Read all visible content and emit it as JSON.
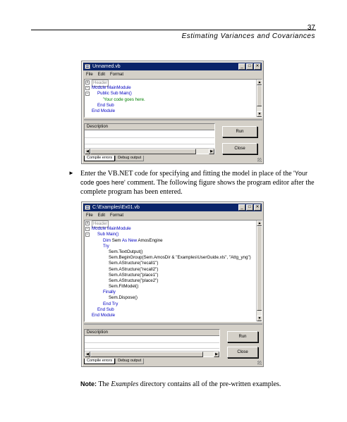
{
  "page": {
    "number": "37",
    "running_head": "Estimating Variances and Covariances"
  },
  "window1": {
    "title": "Unnamed.vb",
    "controls": [
      "_",
      "□",
      "✕"
    ],
    "menu": [
      "File",
      "Edit",
      "Format"
    ],
    "code_lines": [
      {
        "fold": "+",
        "kind": "header",
        "text": "Header"
      },
      {
        "fold": "−",
        "kind": "kw",
        "text": "Module MainModule"
      },
      {
        "fold": "−",
        "kind": "kw",
        "text": "Public Sub Main()"
      },
      {
        "fold": "",
        "kind": "cm",
        "text": "'Your code goes here."
      },
      {
        "fold": "",
        "kind": "kw",
        "text": "End Sub"
      },
      {
        "fold": "",
        "kind": "kw",
        "text": "End Module"
      }
    ],
    "description_header": "Description",
    "run_label": "Run",
    "close_label": "Close",
    "tabs": [
      "Compile errors",
      "Debug output"
    ]
  },
  "paragraph": {
    "part1": "Enter the VB.NET code for specifying and fitting the model in place of the ",
    "code": "'Your code goes here'",
    "part2": " comment. The following figure shows the program editor after the complete program has been entered."
  },
  "window2": {
    "title": "C:\\Examples\\Ex01.vb",
    "controls": [
      "_",
      "□",
      "✕"
    ],
    "menu": [
      "File",
      "Edit",
      "Format"
    ],
    "code_lines": [
      {
        "fold": "+",
        "kind": "header",
        "text": "Header"
      },
      {
        "fold": "−",
        "kind": "kw",
        "text": "Module MainModule"
      },
      {
        "fold": "−",
        "kind": "kw",
        "text": "Sub Main()"
      },
      {
        "fold": "",
        "kind": "mixed",
        "kw": "Dim",
        "text": " Sem ",
        "kw2": "As New",
        "text2": " AmosEngine"
      },
      {
        "fold": "",
        "kind": "kw",
        "text": "Try"
      },
      {
        "fold": "",
        "kind": "plain",
        "text": "Sem.TextOutput()"
      },
      {
        "fold": "",
        "kind": "plain",
        "text": "Sem.BeginGroup(Sem.AmosDir & \"Examples\\UserGuide.xls\", \"Attg_yng\")"
      },
      {
        "fold": "",
        "kind": "plain",
        "text": "Sem.AStructure(\"recall1\")"
      },
      {
        "fold": "",
        "kind": "plain",
        "text": "Sem.AStructure(\"recall2\")"
      },
      {
        "fold": "",
        "kind": "plain",
        "text": "Sem.AStructure(\"place1\")"
      },
      {
        "fold": "",
        "kind": "plain",
        "text": "Sem.AStructure(\"place2\")"
      },
      {
        "fold": "",
        "kind": "plain",
        "text": "Sem.FitModel()"
      },
      {
        "fold": "",
        "kind": "kw",
        "text": "Finally"
      },
      {
        "fold": "",
        "kind": "plain",
        "text": "Sem.Dispose()"
      },
      {
        "fold": "",
        "kind": "kw",
        "text": "End Try"
      },
      {
        "fold": "",
        "kind": "kw",
        "text": "End Sub"
      },
      {
        "fold": "",
        "kind": "kw",
        "text": "End Module"
      }
    ],
    "description_header": "Description",
    "run_label": "Run",
    "close_label": "Close",
    "tabs": [
      "Compile errors",
      "Debug output"
    ]
  },
  "note": {
    "label": "Note:",
    "part1": " The ",
    "em": "Examples",
    "part2": " directory contains all of the pre-written examples."
  },
  "colors": {
    "titlebar": "#0a246a",
    "keyword": "#0000c0",
    "comment": "#008000",
    "chrome": "#d4d0c8"
  }
}
